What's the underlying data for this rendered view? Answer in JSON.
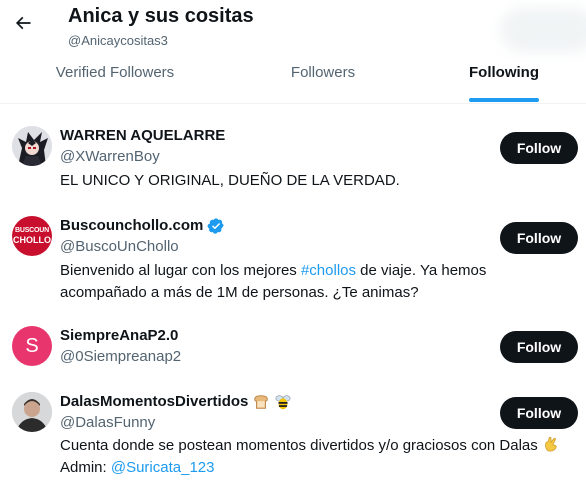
{
  "header": {
    "title": "Anica y sus cositas",
    "handle": "@Anicaycositas3"
  },
  "tabs": [
    {
      "label": "Verified Followers",
      "active": false
    },
    {
      "label": "Followers",
      "active": false
    },
    {
      "label": "Following",
      "active": true
    }
  ],
  "users": [
    {
      "name": "WARREN AQUELARRE",
      "handle": "@XWarrenBoy",
      "bio": "EL UNICO Y ORIGINAL, DUEÑO DE LA VERDAD.",
      "button": "Follow",
      "avatar": "anime-character-avatar"
    },
    {
      "name": "Buscounchollo.com",
      "verified": true,
      "handle": "@BuscoUnChollo",
      "bio_parts": [
        "Bienvenido al lugar con los mejores ",
        "#chollos",
        " de viaje. Ya hemos acompañado a más de 1M de personas. ¿Te animas?"
      ],
      "button": "Follow",
      "avatar_text": [
        "BUSCOUN",
        "CHOLLO"
      ],
      "avatar_color": "#c8102e"
    },
    {
      "name": "SiempreAnaP2.0",
      "handle": "@0Siempreanap2",
      "button": "Follow",
      "avatar_letter": "S",
      "avatar_color": "#e8356d"
    },
    {
      "name": "DalasMomentosDivertidos",
      "name_emojis": [
        "bread-icon",
        "bee-icon"
      ],
      "handle": "@DalasFunny",
      "bio_parts": [
        "Cuenta donde se postean momentos divertidos y/o graciosos con Dalas ",
        "Admin: ",
        "@Suricata_123"
      ],
      "bio_emoji": "calling-hand-icon",
      "button": "Follow",
      "avatar": "person-photo-avatar"
    }
  ],
  "colors": {
    "accent": "#1d9bf0",
    "text": "#0f1419",
    "muted": "#536471",
    "button_bg": "#0f1419"
  }
}
